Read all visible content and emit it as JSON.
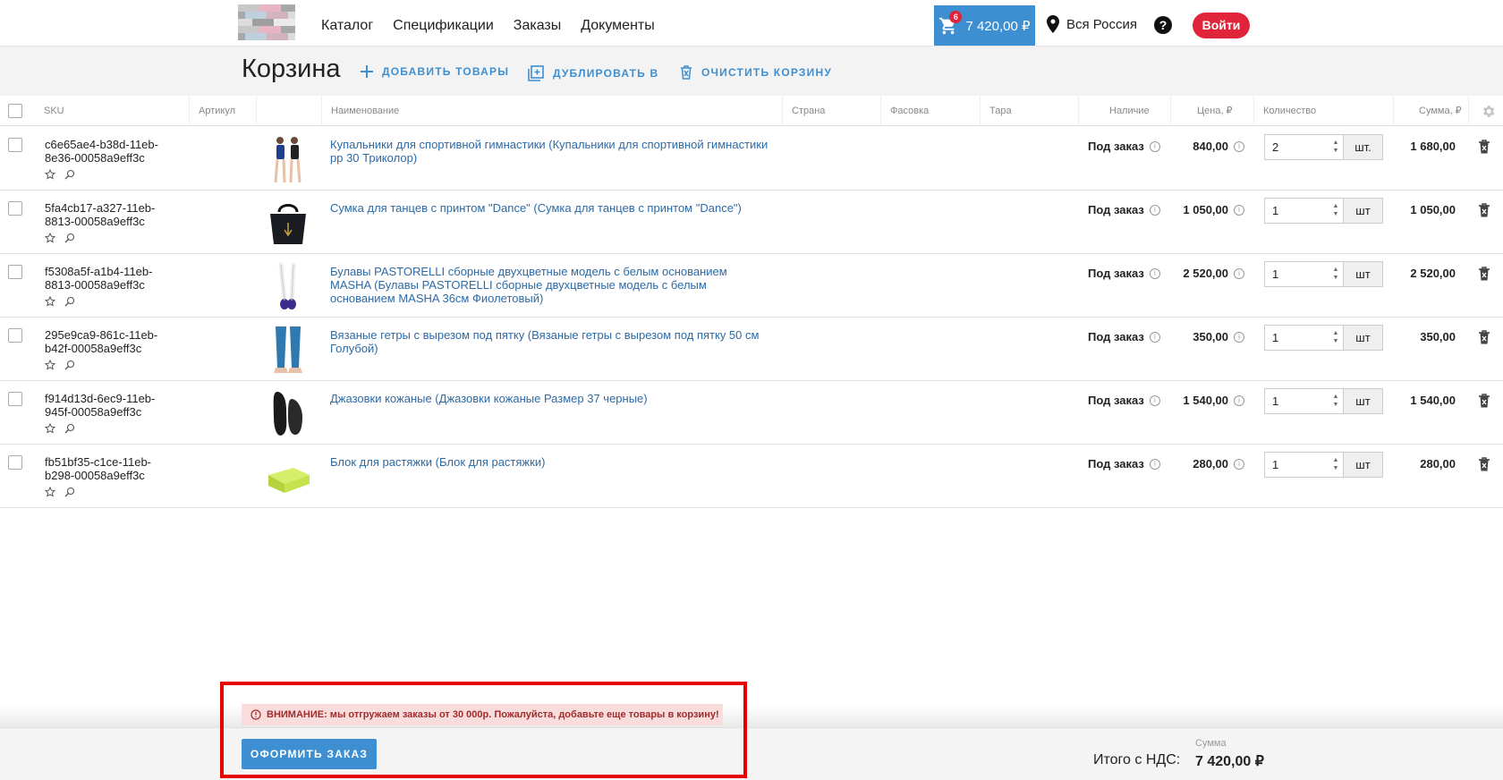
{
  "nav": {
    "items": [
      "Каталог",
      "Спецификации",
      "Заказы",
      "Документы"
    ],
    "cart_total": "7 420,00 ₽",
    "cart_count": "6",
    "region": "Вся Россия",
    "help": "?",
    "login": "Войти"
  },
  "page": {
    "title": "Корзина",
    "add_items": "ДОБАВИТЬ ТОВАРЫ",
    "duplicate": "ДУБЛИРОВАТЬ В",
    "clear_cart": "ОЧИСТИТЬ КОРЗИНУ"
  },
  "table": {
    "columns": [
      "SKU",
      "Артикул",
      "Наименование",
      "Страна",
      "Фасовка",
      "Тара",
      "Наличие",
      "Цена, ₽",
      "Количество",
      "Сумма, ₽"
    ],
    "rows": [
      {
        "sku": "c6e65ae4-b38d-11eb-8e36-00058a9eff3c",
        "name": "Купальники для спортивной гимнастики (Купальники для спортивной гимнастики рр 30 Триколор)",
        "availability": "Под заказ",
        "price": "840,00",
        "qty": "2",
        "unit": "шт.",
        "sum": "1 680,00",
        "thumb": "leotard"
      },
      {
        "sku": "5fa4cb17-a327-11eb-8813-00058a9eff3c",
        "name": "Сумка для танцев с принтом \"Dance\" (Сумка для танцев с принтом \"Dance\")",
        "availability": "Под заказ",
        "price": "1 050,00",
        "qty": "1",
        "unit": "шт",
        "sum": "1 050,00",
        "thumb": "bag"
      },
      {
        "sku": "f5308a5f-a1b4-11eb-8813-00058a9eff3c",
        "name": "Булавы PASTORELLI сборные двухцветные модель с белым основанием MASHA (Булавы PASTORELLI сборные двухцветные модель с белым основанием MASHA 36см Фиолетовый)",
        "availability": "Под заказ",
        "price": "2 520,00",
        "qty": "1",
        "unit": "шт",
        "sum": "2 520,00",
        "thumb": "clubs"
      },
      {
        "sku": "295e9ca9-861c-11eb-b42f-00058a9eff3c",
        "name": "Вязаные гетры с вырезом под пятку (Вязаные гетры с вырезом под пятку 50 см Голубой)",
        "availability": "Под заказ",
        "price": "350,00",
        "qty": "1",
        "unit": "шт",
        "sum": "350,00",
        "thumb": "leggings"
      },
      {
        "sku": "f914d13d-6ec9-11eb-945f-00058a9eff3c",
        "name": "Джазовки кожаные (Джазовки кожаные Размер 37 черные)",
        "availability": "Под заказ",
        "price": "1 540,00",
        "qty": "1",
        "unit": "шт",
        "sum": "1 540,00",
        "thumb": "shoes"
      },
      {
        "sku": "fb51bf35-c1ce-11eb-b298-00058a9eff3c",
        "name": "Блок для растяжки (Блок для растяжки)",
        "availability": "Под заказ",
        "price": "280,00",
        "qty": "1",
        "unit": "шт",
        "sum": "280,00",
        "thumb": "block"
      }
    ]
  },
  "footer": {
    "warning": "ВНИМАНИЕ: мы отгружаем заказы от 30 000р. Пожалуйста, добавьте еще товары в корзину!",
    "order_button": "ОФОРМИТЬ ЗАКАЗ",
    "total_label": "Итого с НДС:",
    "total_caption": "Сумма",
    "total_value": "7 420,00 ₽"
  },
  "colors": {
    "accent": "#3d8fd1",
    "login": "#e0243a",
    "link": "#2d6aa6",
    "warning_bg": "#f9dcdc",
    "highlight": "#e60000"
  },
  "icons": [
    "cart-icon",
    "location-pin-icon",
    "help-icon",
    "plus-icon",
    "duplicate-icon",
    "trash-icon",
    "star-icon",
    "magnifier-icon",
    "info-icon",
    "gear-icon",
    "warning-icon"
  ]
}
